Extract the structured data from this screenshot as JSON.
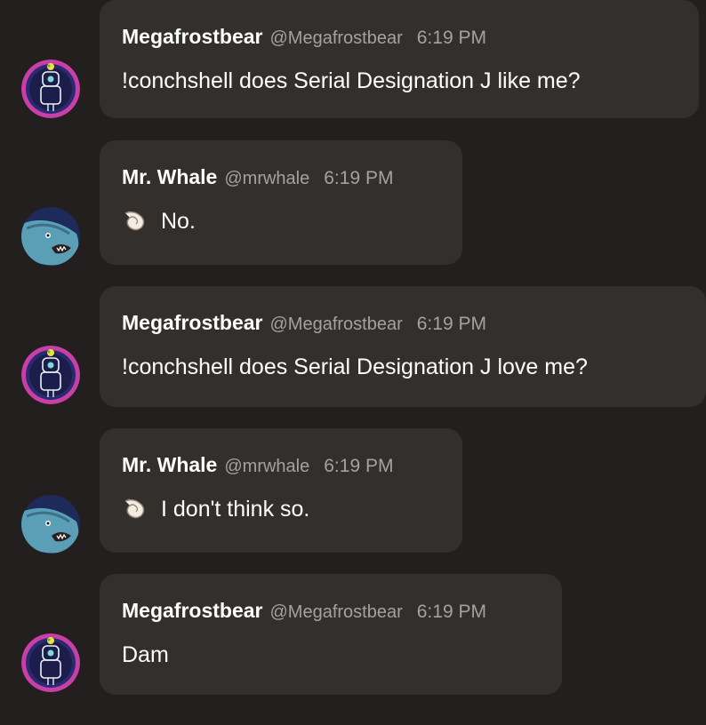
{
  "messages": [
    {
      "author": "Megafrostbear",
      "handle": "@Megafrostbear",
      "time": "6:19 PM",
      "text": "!conchshell does Serial Designation J like me?",
      "avatar": "megafrostbear-avatar",
      "has_shell": false
    },
    {
      "author": "Mr. Whale",
      "handle": "@mrwhale",
      "time": "6:19 PM",
      "text": "No.",
      "avatar": "mr-whale-avatar",
      "has_shell": true,
      "shell_icon": "spiral-shell-icon"
    },
    {
      "author": "Megafrostbear",
      "handle": "@Megafrostbear",
      "time": "6:19 PM",
      "text": "!conchshell does Serial Designation J love me?",
      "avatar": "megafrostbear-avatar",
      "has_shell": false
    },
    {
      "author": "Mr. Whale",
      "handle": "@mrwhale",
      "time": "6:19 PM",
      "text": "I don't think so.",
      "avatar": "mr-whale-avatar",
      "has_shell": true,
      "shell_icon": "spiral-shell-icon"
    },
    {
      "author": "Megafrostbear",
      "handle": "@Megafrostbear",
      "time": "6:19 PM",
      "text": "Dam",
      "avatar": "megafrostbear-avatar",
      "has_shell": false
    }
  ],
  "colors": {
    "background": "#221f1e",
    "bubble": "#332f2d",
    "name": "#ffffff",
    "meta": "#a5a19e"
  }
}
